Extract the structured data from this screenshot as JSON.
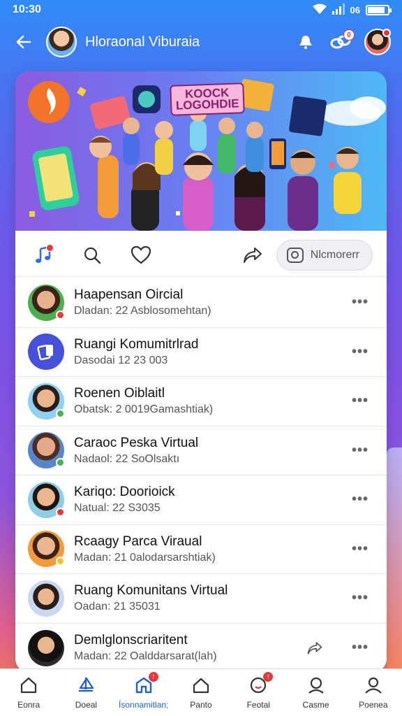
{
  "status_bar": {
    "time": "10:30",
    "signal_text": "06"
  },
  "app_bar": {
    "title": "Hlorаonal Viburaia",
    "notification_badge": "0"
  },
  "banner": {
    "title": "KOOCK LOGOHDIE"
  },
  "actions": {
    "pill_label": "Nlcmorerr"
  },
  "rows": [
    {
      "name": "Haapensan Oircial",
      "sub": "Dladan: 22 Asblosomehtan)",
      "status_color": "#e5383b",
      "avatar_colors": [
        "#4caf50",
        "#e8b08c"
      ]
    },
    {
      "name": "Ruangi Komumitrlrad",
      "sub": "Dasodai 12 23 003",
      "status_color": "",
      "avatar_colors": [
        "#4650d8",
        "#ffffff"
      ]
    },
    {
      "name": "Roenen Oiblaitl",
      "sub": "Obatsk: 2 0019Gamashtiak)",
      "status_color": "#4caf50",
      "avatar_colors": [
        "#8fd0f5",
        "#e9b690"
      ]
    },
    {
      "name": "Caraoc Peska Virtual",
      "sub": "Nadaol: 22 SoOlsaktı",
      "status_color": "#4caf50",
      "avatar_colors": [
        "#5a86c9",
        "#e6a98a"
      ]
    },
    {
      "name": "Kariqo: Doorioick",
      "sub": "Natual: 22 S3035",
      "status_color": "#e5383b",
      "avatar_colors": [
        "#8ecfe6",
        "#e9b690"
      ]
    },
    {
      "name": "Rcaagy Parca Viraual",
      "sub": "Madan: 21 0alodarsarshtiak)",
      "status_color": "#f4c430",
      "avatar_colors": [
        "#f39a3a",
        "#e9b690"
      ]
    },
    {
      "name": "Ruang Komunitans Virtual",
      "sub": "Oadan: 21 35031",
      "status_color": "",
      "avatar_colors": [
        "#c9d8f0",
        "#e9b690"
      ]
    },
    {
      "name": "Demlglonscriaritent",
      "sub": "Madan: 22 Oalddarsarat(lah)",
      "status_color": "",
      "avatar_colors": [
        "#2c2c2c",
        "#e9b690"
      ]
    }
  ],
  "nav": [
    {
      "label": "Eonra",
      "icon": "home-icon",
      "badge": ""
    },
    {
      "label": "Doeal",
      "icon": "sailboat-icon",
      "badge": ""
    },
    {
      "label": "Ísonnamitlan;",
      "icon": "community-icon",
      "badge": "!"
    },
    {
      "label": "Panto",
      "icon": "home-outline-icon",
      "badge": ""
    },
    {
      "label": "Feotal",
      "icon": "face-icon",
      "badge": "!"
    },
    {
      "label": "Casme",
      "icon": "user-icon",
      "badge": ""
    },
    {
      "label": "Poenea",
      "icon": "profile-icon",
      "badge": ""
    }
  ],
  "colors": {
    "accent": "#1e5fd8",
    "alert": "#e5383b"
  }
}
